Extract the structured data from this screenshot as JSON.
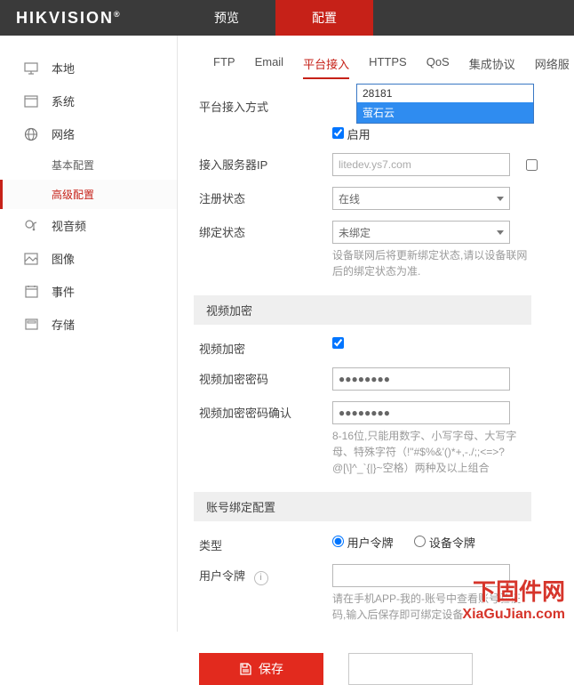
{
  "brand": "HIKVISION",
  "topnav": {
    "preview": "预览",
    "config": "配置"
  },
  "sidebar": {
    "local": "本地",
    "system": "系统",
    "network": "网络",
    "network_basic": "基本配置",
    "network_adv": "高级配置",
    "av": "视音频",
    "image": "图像",
    "event": "事件",
    "storage": "存储"
  },
  "tabs": {
    "ftp": "FTP",
    "email": "Email",
    "platform": "平台接入",
    "https": "HTTPS",
    "qos": "QoS",
    "proto": "集成协议",
    "netsvc": "网络服"
  },
  "dropdown": {
    "opt1": "28181",
    "opt2": "萤石云"
  },
  "form": {
    "access_mode_label": "平台接入方式",
    "enable_label": "启用",
    "server_ip_label": "接入服务器IP",
    "server_ip_value": "litedev.ys7.com",
    "reg_status_label": "注册状态",
    "reg_status_value": "在线",
    "bind_status_label": "绑定状态",
    "bind_status_value": "未绑定",
    "bind_help": "设备联网后将更新绑定状态,请以设备联网后的绑定状态为准.",
    "section_encrypt": "视频加密",
    "encrypt_label": "视频加密",
    "encrypt_pwd_label": "视频加密密码",
    "encrypt_pwd_value": "●●●●●●●●",
    "encrypt_pwd2_label": "视频加密密码确认",
    "encrypt_pwd2_value": "●●●●●●●●",
    "pwd_help": "8-16位,只能用数字、小写字母、大写字母、特殊字符（!\"#$%&'()*+,-./;;<=>?@[\\]^_`{|}~空格）两种及以上组合",
    "section_bind": "账号绑定配置",
    "type_label": "类型",
    "type_user_token": "用户令牌",
    "type_device_token": "设备令牌",
    "user_token_label": "用户令牌",
    "token_help": "请在手机APP-我的-账号中查看账号验证码,输入后保存即可绑定设备"
  },
  "buttons": {
    "save": "保存"
  },
  "watermark": {
    "cn": "下固件网",
    "en": "XiaGuJian.com"
  }
}
